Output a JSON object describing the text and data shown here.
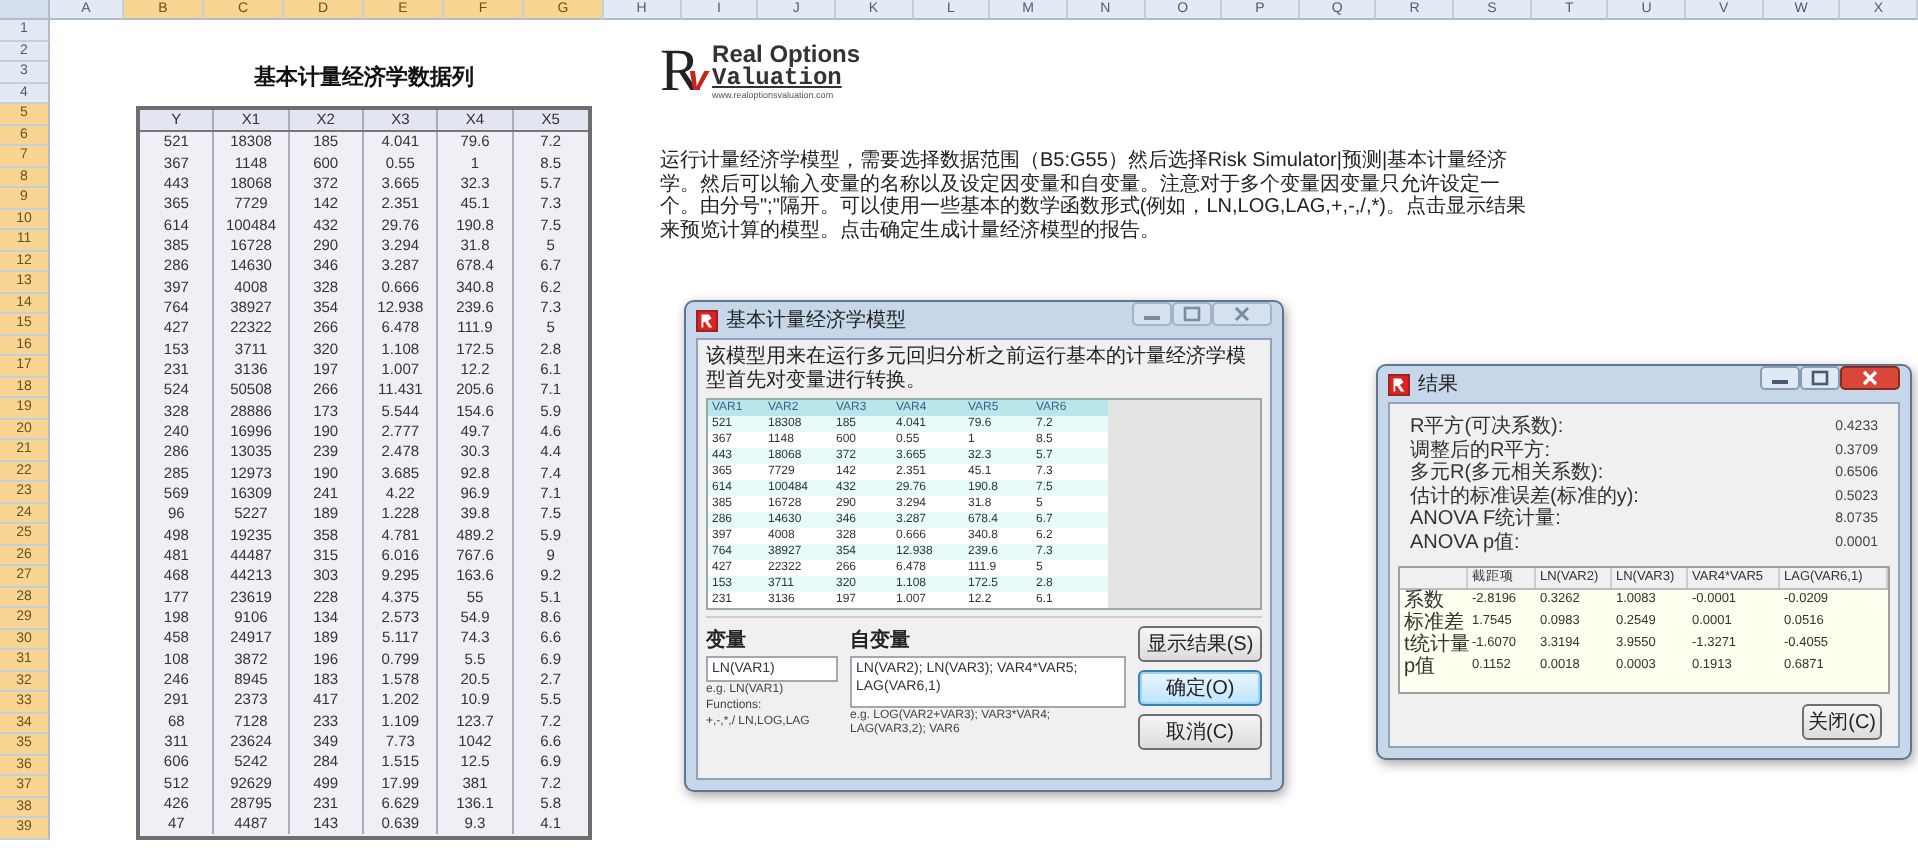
{
  "sheet": {
    "columns": [
      {
        "label": "A",
        "selected": false
      },
      {
        "label": "B",
        "selected": true
      },
      {
        "label": "C",
        "selected": true
      },
      {
        "label": "D",
        "selected": true
      },
      {
        "label": "E",
        "selected": true
      },
      {
        "label": "F",
        "selected": true
      },
      {
        "label": "G",
        "selected": true
      },
      {
        "label": "H",
        "selected": false
      },
      {
        "label": "I",
        "selected": false
      },
      {
        "label": "J",
        "selected": false
      },
      {
        "label": "K",
        "selected": false
      },
      {
        "label": "L",
        "selected": false
      },
      {
        "label": "M",
        "selected": false
      },
      {
        "label": "N",
        "selected": false
      },
      {
        "label": "O",
        "selected": false
      },
      {
        "label": "P",
        "selected": false
      },
      {
        "label": "Q",
        "selected": false
      },
      {
        "label": "R",
        "selected": false
      },
      {
        "label": "S",
        "selected": false
      },
      {
        "label": "T",
        "selected": false
      },
      {
        "label": "U",
        "selected": false
      },
      {
        "label": "V",
        "selected": false
      },
      {
        "label": "W",
        "selected": false
      },
      {
        "label": "X",
        "selected": false
      }
    ],
    "rows": [
      {
        "label": "1",
        "selected": false
      },
      {
        "label": "2",
        "selected": false
      },
      {
        "label": "3",
        "selected": false
      },
      {
        "label": "4",
        "selected": false
      },
      {
        "label": "5",
        "selected": true
      },
      {
        "label": "6",
        "selected": true
      },
      {
        "label": "7",
        "selected": true
      },
      {
        "label": "8",
        "selected": true
      },
      {
        "label": "9",
        "selected": true
      },
      {
        "label": "10",
        "selected": true
      },
      {
        "label": "11",
        "selected": true
      },
      {
        "label": "12",
        "selected": true
      },
      {
        "label": "13",
        "selected": true
      },
      {
        "label": "14",
        "selected": true
      },
      {
        "label": "15",
        "selected": true
      },
      {
        "label": "16",
        "selected": true
      },
      {
        "label": "17",
        "selected": true
      },
      {
        "label": "18",
        "selected": true
      },
      {
        "label": "19",
        "selected": true
      },
      {
        "label": "20",
        "selected": true
      },
      {
        "label": "21",
        "selected": true
      },
      {
        "label": "22",
        "selected": true
      },
      {
        "label": "23",
        "selected": true
      },
      {
        "label": "24",
        "selected": true
      },
      {
        "label": "25",
        "selected": true
      },
      {
        "label": "26",
        "selected": true
      },
      {
        "label": "27",
        "selected": true
      },
      {
        "label": "28",
        "selected": true
      },
      {
        "label": "29",
        "selected": true
      },
      {
        "label": "30",
        "selected": true
      },
      {
        "label": "31",
        "selected": true
      },
      {
        "label": "32",
        "selected": true
      },
      {
        "label": "33",
        "selected": true
      },
      {
        "label": "34",
        "selected": true
      },
      {
        "label": "35",
        "selected": true
      },
      {
        "label": "36",
        "selected": true
      },
      {
        "label": "37",
        "selected": true
      },
      {
        "label": "38",
        "selected": true
      },
      {
        "label": "39",
        "selected": true
      }
    ],
    "title": "基本计量经济学数据列",
    "data_table": {
      "columns": [
        "Y",
        "X1",
        "X2",
        "X3",
        "X4",
        "X5"
      ],
      "rows": [
        [
          "521",
          "18308",
          "185",
          "4.041",
          "79.6",
          "7.2"
        ],
        [
          "367",
          "1148",
          "600",
          "0.55",
          "1",
          "8.5"
        ],
        [
          "443",
          "18068",
          "372",
          "3.665",
          "32.3",
          "5.7"
        ],
        [
          "365",
          "7729",
          "142",
          "2.351",
          "45.1",
          "7.3"
        ],
        [
          "614",
          "100484",
          "432",
          "29.76",
          "190.8",
          "7.5"
        ],
        [
          "385",
          "16728",
          "290",
          "3.294",
          "31.8",
          "5"
        ],
        [
          "286",
          "14630",
          "346",
          "3.287",
          "678.4",
          "6.7"
        ],
        [
          "397",
          "4008",
          "328",
          "0.666",
          "340.8",
          "6.2"
        ],
        [
          "764",
          "38927",
          "354",
          "12.938",
          "239.6",
          "7.3"
        ],
        [
          "427",
          "22322",
          "266",
          "6.478",
          "111.9",
          "5"
        ],
        [
          "153",
          "3711",
          "320",
          "1.108",
          "172.5",
          "2.8"
        ],
        [
          "231",
          "3136",
          "197",
          "1.007",
          "12.2",
          "6.1"
        ],
        [
          "524",
          "50508",
          "266",
          "11.431",
          "205.6",
          "7.1"
        ],
        [
          "328",
          "28886",
          "173",
          "5.544",
          "154.6",
          "5.9"
        ],
        [
          "240",
          "16996",
          "190",
          "2.777",
          "49.7",
          "4.6"
        ],
        [
          "286",
          "13035",
          "239",
          "2.478",
          "30.3",
          "4.4"
        ],
        [
          "285",
          "12973",
          "190",
          "3.685",
          "92.8",
          "7.4"
        ],
        [
          "569",
          "16309",
          "241",
          "4.22",
          "96.9",
          "7.1"
        ],
        [
          "96",
          "5227",
          "189",
          "1.228",
          "39.8",
          "7.5"
        ],
        [
          "498",
          "19235",
          "358",
          "4.781",
          "489.2",
          "5.9"
        ],
        [
          "481",
          "44487",
          "315",
          "6.016",
          "767.6",
          "9"
        ],
        [
          "468",
          "44213",
          "303",
          "9.295",
          "163.6",
          "9.2"
        ],
        [
          "177",
          "23619",
          "228",
          "4.375",
          "55",
          "5.1"
        ],
        [
          "198",
          "9106",
          "134",
          "2.573",
          "54.9",
          "8.6"
        ],
        [
          "458",
          "24917",
          "189",
          "5.117",
          "74.3",
          "6.6"
        ],
        [
          "108",
          "3872",
          "196",
          "0.799",
          "5.5",
          "6.9"
        ],
        [
          "246",
          "8945",
          "183",
          "1.578",
          "20.5",
          "2.7"
        ],
        [
          "291",
          "2373",
          "417",
          "1.202",
          "10.9",
          "5.5"
        ],
        [
          "68",
          "7128",
          "233",
          "1.109",
          "123.7",
          "7.2"
        ],
        [
          "311",
          "23624",
          "349",
          "7.73",
          "1042",
          "6.6"
        ],
        [
          "606",
          "5242",
          "284",
          "1.515",
          "12.5",
          "6.9"
        ],
        [
          "512",
          "92629",
          "499",
          "17.99",
          "381",
          "7.2"
        ],
        [
          "426",
          "28795",
          "231",
          "6.629",
          "136.1",
          "5.8"
        ],
        [
          "47",
          "4487",
          "143",
          "0.639",
          "9.3",
          "4.1"
        ]
      ]
    },
    "logo": {
      "mark": "R",
      "accent": "v",
      "line1": "Real Options",
      "line2": "Valuation",
      "url": "www.realoptionsvaluation.com"
    },
    "instructions": "运行计量经济学模型，需要选择数据范围（B5:G55）然后选择Risk Simulator|预测|基本计量经济学。然后可以输入变量的名称以及设定因变量和自变量。注意对于多个变量因变量只允许设定一个。由分号\";\"隔开。可以使用一些基本的数学函数形式(例如，LN,LOG,LAG,+,-,/,*)。点击显示结果来预览计算的模型。点击确定生成计量经济模型的报告。"
  },
  "model_dialog": {
    "title": "基本计量经济学模型",
    "description": "该模型用来在运行多元回归分析之前运行基本的计量经济学模型首先对变量进行转换。",
    "grid": {
      "columns": [
        "VAR1",
        "VAR2",
        "VAR3",
        "VAR4",
        "VAR5",
        "VAR6"
      ],
      "rows": [
        [
          "521",
          "18308",
          "185",
          "4.041",
          "79.6",
          "7.2"
        ],
        [
          "367",
          "1148",
          "600",
          "0.55",
          "1",
          "8.5"
        ],
        [
          "443",
          "18068",
          "372",
          "3.665",
          "32.3",
          "5.7"
        ],
        [
          "365",
          "7729",
          "142",
          "2.351",
          "45.1",
          "7.3"
        ],
        [
          "614",
          "100484",
          "432",
          "29.76",
          "190.8",
          "7.5"
        ],
        [
          "385",
          "16728",
          "290",
          "3.294",
          "31.8",
          "5"
        ],
        [
          "286",
          "14630",
          "346",
          "3.287",
          "678.4",
          "6.7"
        ],
        [
          "397",
          "4008",
          "328",
          "0.666",
          "340.8",
          "6.2"
        ],
        [
          "764",
          "38927",
          "354",
          "12.938",
          "239.6",
          "7.3"
        ],
        [
          "427",
          "22322",
          "266",
          "6.478",
          "111.9",
          "5"
        ],
        [
          "153",
          "3711",
          "320",
          "1.108",
          "172.5",
          "2.8"
        ],
        [
          "231",
          "3136",
          "197",
          "1.007",
          "12.2",
          "6.1"
        ]
      ]
    },
    "dependent": {
      "label": "变量",
      "value": "LN(VAR1)",
      "hint": "e.g. LN(VAR1)",
      "functions_label": "Functions:",
      "functions": "+,-,*,/ LN,LOG,LAG"
    },
    "independent": {
      "label": "自变量",
      "value": "LN(VAR2); LN(VAR3); VAR4*VAR5; LAG(VAR6,1)",
      "hint": "e.g. LOG(VAR2+VAR3); VAR3*VAR4; LAG(VAR3,2); VAR6"
    },
    "buttons": [
      {
        "label": "显示结果(S)",
        "default": false
      },
      {
        "label": "确定(O)",
        "default": true
      },
      {
        "label": "取消(C)",
        "default": false
      }
    ]
  },
  "results_dialog": {
    "title": "结果",
    "stats": [
      {
        "label": "R平方(可决系数):",
        "value": "0.4233"
      },
      {
        "label": "调整后的R平方:",
        "value": "0.3709"
      },
      {
        "label": "多元R(多元相关系数):",
        "value": "0.6506"
      },
      {
        "label": "估计的标准误差(标准的y):",
        "value": "0.5023"
      },
      {
        "label": "ANOVA F统计量:",
        "value": "8.0735"
      },
      {
        "label": "ANOVA p值:",
        "value": "0.0001"
      }
    ],
    "table": {
      "columns": [
        "截距项",
        "LN(VAR2)",
        "LN(VAR3)",
        "VAR4*VAR5",
        "LAG(VAR6,1)"
      ],
      "rows": [
        {
          "label": "系数",
          "values": [
            "-2.8196",
            "0.3262",
            "1.0083",
            "-0.0001",
            "-0.0209"
          ]
        },
        {
          "label": "标准差",
          "values": [
            "1.7545",
            "0.0983",
            "0.2549",
            "0.0001",
            "0.0516"
          ]
        },
        {
          "label": "t统计量",
          "values": [
            "-1.6070",
            "3.3194",
            "3.9550",
            "-1.3271",
            "-0.4055"
          ]
        },
        {
          "label": "p值",
          "values": [
            "0.1152",
            "0.0018",
            "0.0003",
            "0.1913",
            "0.6871"
          ]
        }
      ]
    },
    "buttons": [
      {
        "label": "关闭(C)",
        "default": false
      }
    ]
  }
}
